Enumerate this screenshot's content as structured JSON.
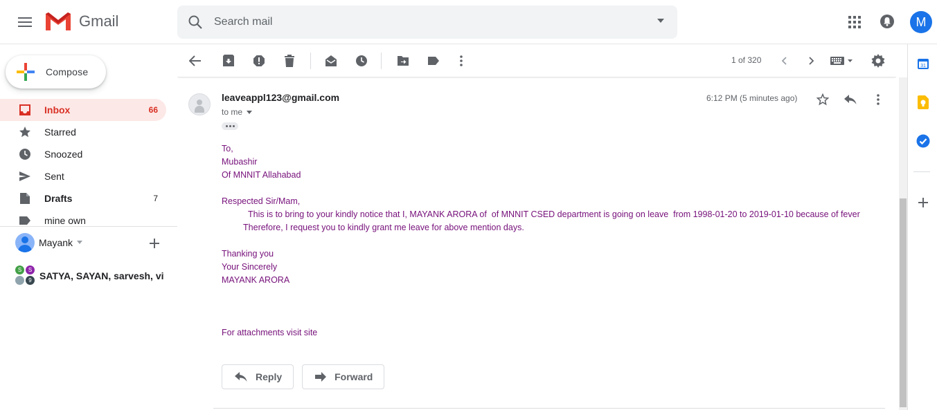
{
  "app": {
    "brand": "Gmail",
    "avatar_letter": "M",
    "colors": {
      "accent": "#d93025",
      "body_text": "#76107a",
      "avatar": "#1a73e8"
    }
  },
  "search": {
    "placeholder": "Search mail",
    "icon": "search-icon"
  },
  "sidebar": {
    "compose_label": "Compose",
    "items": [
      {
        "label": "Inbox",
        "count": "66",
        "icon": "inbox-icon"
      },
      {
        "label": "Starred",
        "count": "",
        "icon": "star-icon"
      },
      {
        "label": "Snoozed",
        "count": "",
        "icon": "clock-icon"
      },
      {
        "label": "Sent",
        "count": "",
        "icon": "send-icon"
      },
      {
        "label": "Drafts",
        "count": "7",
        "icon": "draft-icon"
      },
      {
        "label": "mine own",
        "count": "",
        "icon": "label-icon"
      }
    ],
    "hangouts_user": "Mayank",
    "group_chat": {
      "name": "SATYA, SAYAN, sarvesh, vive",
      "avatars": [
        "S",
        "S",
        "",
        "9"
      ]
    }
  },
  "toolbar": {
    "pager_text": "1 of 320"
  },
  "message": {
    "sender": "leaveappl123@gmail.com",
    "recipient_label": "to me",
    "time": "6:12 PM (5 minutes ago)",
    "body_lines": [
      "To,",
      "Mubashir",
      "Of MNNIT Allahabad",
      "",
      "Respected Sir/Mam,",
      "           This is to bring to your kindly notice that I, MAYANK ARORA of  of MNNIT CSED department is going on leave  from 1998-01-20 to 2019-01-10 because of fever",
      "         Therefore, I request you to kindly grant me leave for above mention days.",
      "",
      "Thanking you",
      "Your Sincerely",
      "MAYANK ARORA",
      "",
      "",
      "",
      "For attachments visit site"
    ],
    "reply_label": "Reply",
    "forward_label": "Forward"
  }
}
